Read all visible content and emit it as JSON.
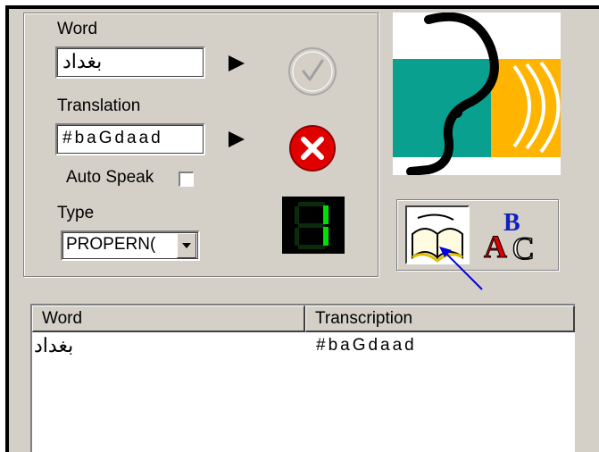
{
  "form": {
    "word_label": "Word",
    "word_value": "بغداد",
    "translation_label": "Translation",
    "translation_value": "#baGdaad",
    "auto_speak_label": "Auto Speak",
    "auto_speak_checked": false,
    "type_label": "Type",
    "type_value": "PROPERN(",
    "counter_value": "1"
  },
  "list": {
    "columns": [
      "Word",
      "Transcription"
    ],
    "rows": [
      {
        "word": "بغداد",
        "transcription": "#baGdaad"
      }
    ]
  },
  "icons": {
    "accept": "check-icon",
    "cancel": "red-x-icon",
    "dictionary": "open-book-icon",
    "spelling": "abc-icon"
  },
  "colors": {
    "window_bg": "#d4d0c8",
    "cancel_red": "#e00000",
    "logo_teal": "#0aa090",
    "logo_orange": "#ffb400",
    "pointer_arrow": "#0000e0",
    "counter_green": "#00e000"
  }
}
